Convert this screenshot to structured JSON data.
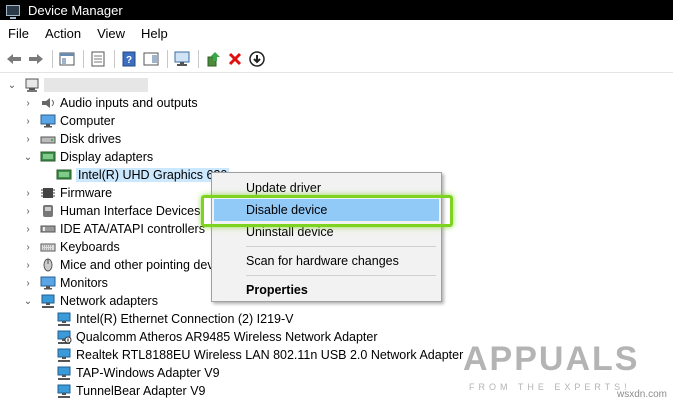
{
  "window": {
    "title": "Device Manager"
  },
  "menu": [
    "File",
    "Action",
    "View",
    "Help"
  ],
  "tree": {
    "categories": [
      {
        "label": "Audio inputs and outputs",
        "icon": "speaker-icon",
        "expanded": false
      },
      {
        "label": "Computer",
        "icon": "monitor-icon",
        "expanded": false
      },
      {
        "label": "Disk drives",
        "icon": "disk-drive-icon",
        "expanded": false
      },
      {
        "label": "Display adapters",
        "icon": "display-adapter-icon",
        "expanded": true,
        "children": [
          {
            "label": "Intel(R) UHD Graphics 630",
            "icon": "display-adapter-icon"
          }
        ]
      },
      {
        "label": "Firmware",
        "icon": "chip-icon",
        "expanded": false
      },
      {
        "label": "Human Interface Devices",
        "icon": "hid-icon",
        "expanded": false
      },
      {
        "label": "IDE ATA/ATAPI controllers",
        "icon": "controller-icon",
        "expanded": false
      },
      {
        "label": "Keyboards",
        "icon": "keyboard-icon",
        "expanded": false
      },
      {
        "label": "Mice and other pointing devices",
        "icon": "mouse-icon",
        "expanded": false
      },
      {
        "label": "Monitors",
        "icon": "monitor-icon",
        "expanded": false
      },
      {
        "label": "Network adapters",
        "icon": "network-adapter-icon",
        "expanded": true,
        "children": [
          {
            "label": "Intel(R) Ethernet Connection (2) I219-V",
            "icon": "network-adapter-icon"
          },
          {
            "label": "Qualcomm Atheros AR9485 Wireless Network Adapter",
            "icon": "network-adapter-icon"
          },
          {
            "label": "Realtek RTL8188EU Wireless LAN 802.11n USB 2.0 Network Adapter",
            "icon": "network-adapter-icon"
          },
          {
            "label": "TAP-Windows Adapter V9",
            "icon": "network-adapter-icon"
          },
          {
            "label": "TunnelBear Adapter V9",
            "icon": "network-adapter-icon"
          }
        ]
      }
    ]
  },
  "context_menu": {
    "items": [
      {
        "label": "Update driver"
      },
      {
        "label": "Disable device",
        "highlighted": true
      },
      {
        "label": "Uninstall device"
      },
      {
        "label": "Scan for hardware changes"
      },
      {
        "label": "Properties",
        "bold": true
      }
    ]
  },
  "watermark": {
    "logo": "APPUALS",
    "tagline": "FROM THE EXPERTS!"
  },
  "site": "wsxdn.com",
  "colors": {
    "titlebar": "#000000",
    "highlight": "#91c9f7",
    "callout": "#7ed321"
  }
}
